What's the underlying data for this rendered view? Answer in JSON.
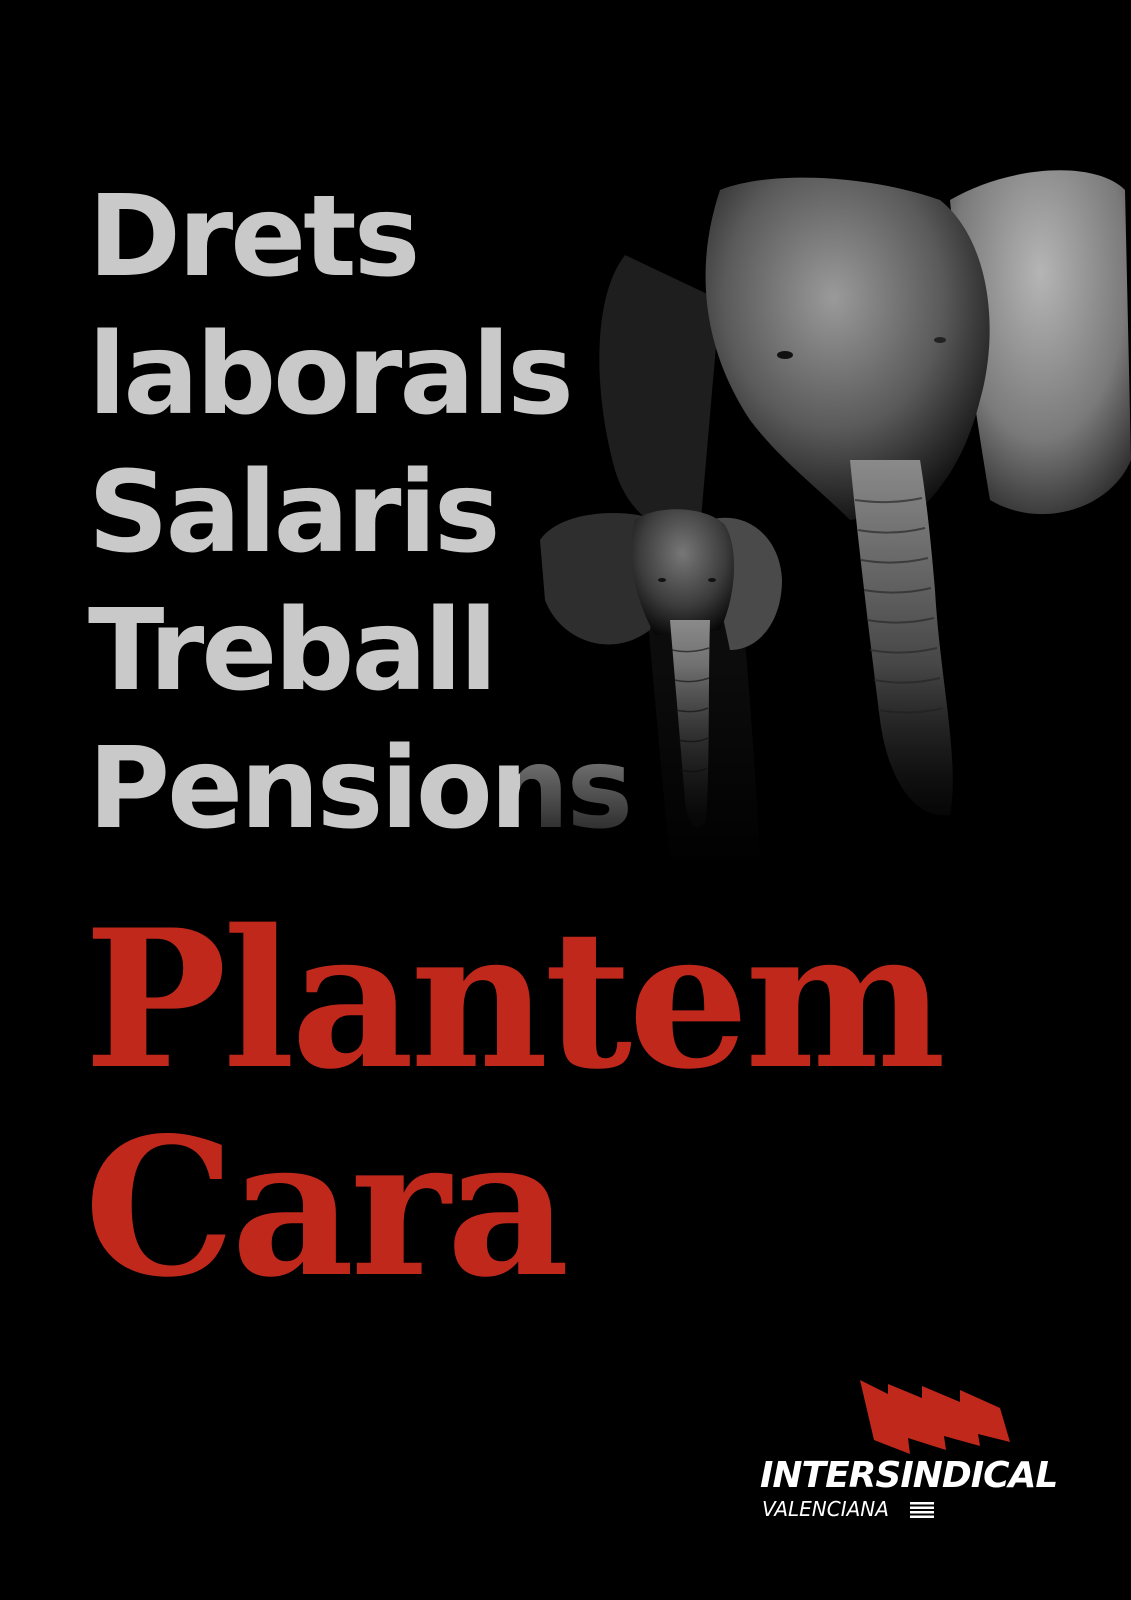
{
  "poster": {
    "topics": [
      "Drets",
      "laborals",
      "Salaris",
      "Treball",
      "Pensions"
    ],
    "slogan": {
      "line1": "Plantem",
      "line2": "Cara"
    },
    "image": {
      "subject": "adult and baby elephant (black and white photo)"
    },
    "logo": {
      "name": "INTERSINDICAL",
      "subtitle": "VALENCIANA",
      "icon": "flag-icon"
    }
  },
  "colors": {
    "background": "#000000",
    "topic_text": "#c9c9c9",
    "slogan_text": "#c1281c",
    "logo_flag": "#c1281c",
    "logo_text": "#ffffff"
  }
}
